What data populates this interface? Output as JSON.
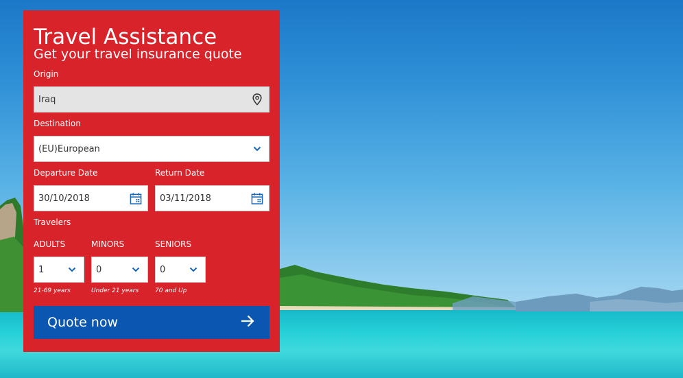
{
  "header": {
    "title": "Travel Assistance",
    "subtitle": "Get your travel insurance quote"
  },
  "origin": {
    "label": "Origin",
    "value": "Iraq",
    "icon": "location-pin-icon"
  },
  "destination": {
    "label": "Destination",
    "value": "(EU)European",
    "icon": "chevron-down-icon"
  },
  "departure": {
    "label": "Departure Date",
    "value": "30/10/2018",
    "icon": "calendar-icon"
  },
  "return": {
    "label": "Return Date",
    "value": "03/11/2018",
    "icon": "calendar-icon"
  },
  "travelers": {
    "label": "Travelers",
    "adults": {
      "label": "ADULTS",
      "value": "1",
      "hint": "21-69 years"
    },
    "minors": {
      "label": "MINORS",
      "value": "0",
      "hint": "Under 21 years"
    },
    "seniors": {
      "label": "SENIORS",
      "value": "0",
      "hint": "70 and Up"
    }
  },
  "quote_button": {
    "label": "Quote now",
    "icon": "arrow-right-icon"
  },
  "colors": {
    "panel": "#d8232a",
    "button": "#0a56b0",
    "icon_blue": "#1565b8",
    "text_white": "#ffffff"
  }
}
